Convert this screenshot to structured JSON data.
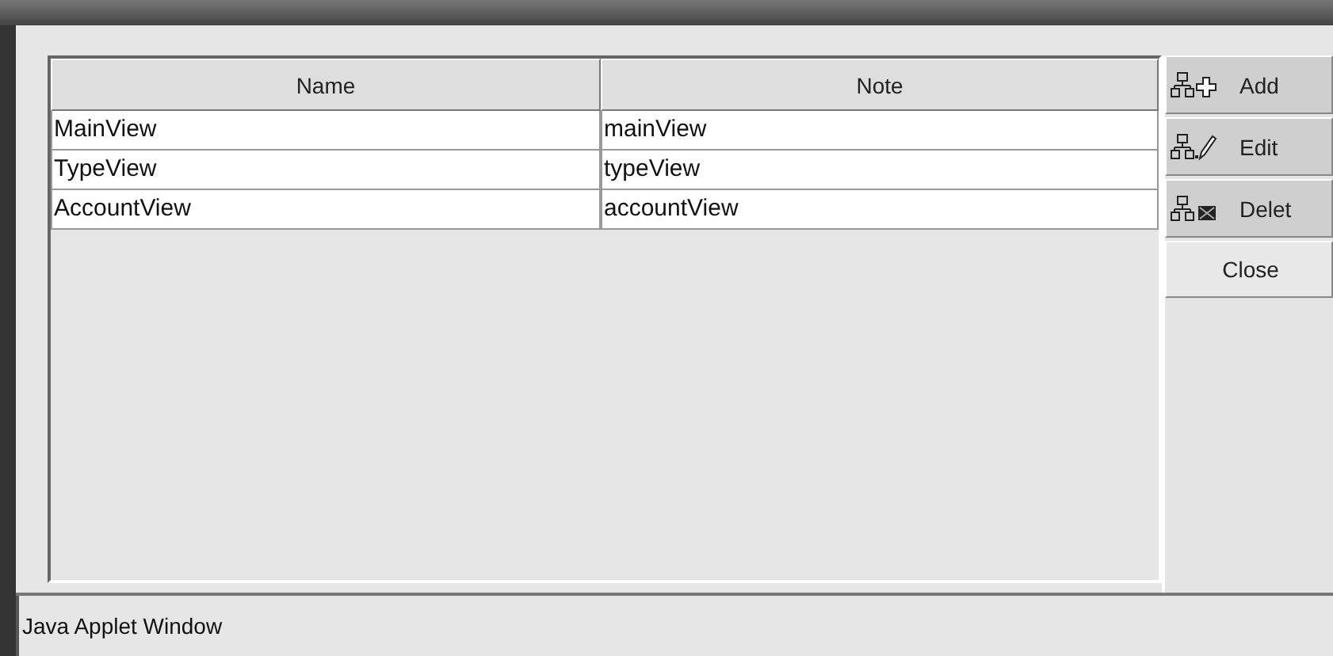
{
  "table": {
    "columns": [
      "Name",
      "Note"
    ],
    "rows": [
      {
        "cells": [
          "MainView",
          "mainView"
        ]
      },
      {
        "cells": [
          "TypeView",
          "typeView"
        ]
      },
      {
        "cells": [
          "AccountView",
          "accountView"
        ]
      }
    ]
  },
  "buttons": [
    {
      "kind": "add",
      "label": "Add"
    },
    {
      "kind": "edit",
      "label": "Edit"
    },
    {
      "kind": "delete",
      "label": "Delet"
    },
    {
      "kind": "plain",
      "label": "Close"
    }
  ],
  "status_bar": "Java Applet Window"
}
